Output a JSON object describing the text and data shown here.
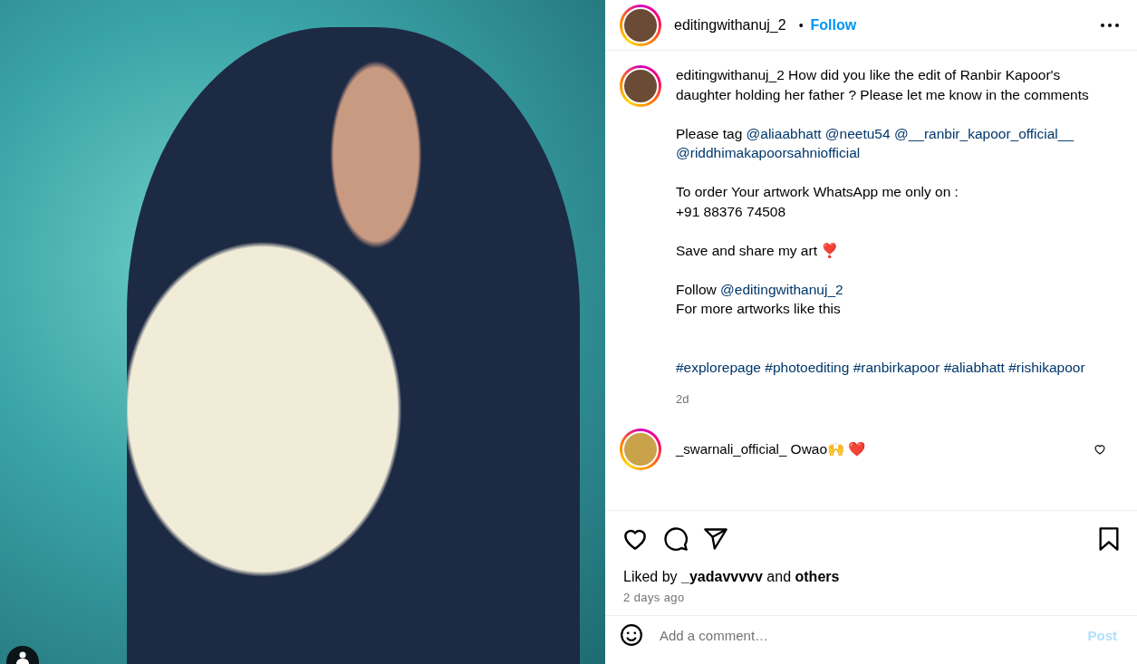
{
  "post_header": {
    "username": "editingwithanuj_2",
    "separator": "•",
    "follow_label": "Follow"
  },
  "caption": {
    "username": "editingwithanuj_2",
    "paragraphs": [
      {
        "kind": "plain",
        "segments": [
          {
            "kind": "text",
            "text": "How did you like the edit of Ranbir Kapoor's daughter holding her father ? Please let me know in the comments"
          }
        ]
      },
      {
        "kind": "plain",
        "segments": [
          {
            "kind": "text",
            "text": "Please tag"
          },
          {
            "kind": "link",
            "text": "@aliaabhatt"
          },
          {
            "kind": "link",
            "text": "@neetu54"
          },
          {
            "kind": "link",
            "text": "@__ranbir_kapoor_official__"
          },
          {
            "kind": "link",
            "text": "@riddhimakapoorsahniofficial"
          }
        ]
      },
      {
        "kind": "plain",
        "segments": [
          {
            "kind": "text",
            "text": "To order Your artwork WhatsApp me only on :\n+91 88376 74508"
          }
        ]
      },
      {
        "kind": "plain",
        "segments": [
          {
            "kind": "text",
            "text": "Save and share my art ❣️"
          }
        ]
      },
      {
        "kind": "plain",
        "segments": [
          {
            "kind": "text",
            "text": "Follow"
          },
          {
            "kind": "link",
            "text": "@editingwithanuj_2"
          },
          {
            "kind": "text",
            "text": "\nFor more artworks like this"
          }
        ]
      },
      {
        "kind": "tags",
        "segments": [
          {
            "kind": "link",
            "text": "#explorepage"
          },
          {
            "kind": "link",
            "text": "#photoediting"
          },
          {
            "kind": "link",
            "text": "#ranbirkapoor"
          },
          {
            "kind": "link",
            "text": "#aliabhatt"
          },
          {
            "kind": "link",
            "text": "#rishikapoor"
          }
        ]
      }
    ],
    "time": "2d"
  },
  "comments": [
    {
      "username": "_swarnali_official_",
      "text": "Owao🙌 ❤️",
      "liked": false
    }
  ],
  "actions": {
    "liked": false,
    "saved": false
  },
  "likes": "Liked by **_yadavvvvv** and **others**",
  "date": "2 days ago",
  "add_comment": {
    "placeholder": "Add a comment…",
    "post_label": "Post"
  }
}
